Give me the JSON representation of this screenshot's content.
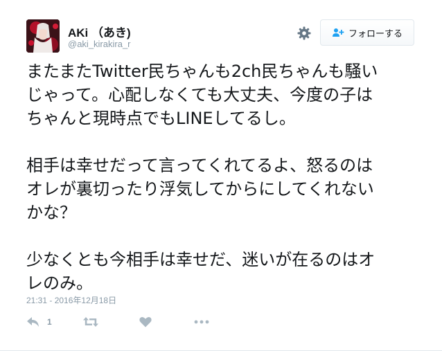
{
  "user": {
    "display_name": "AKi （あき)",
    "handle": "@aki_kirakira_r"
  },
  "actions_top": {
    "follow_label": "フォロー",
    "follow_suffix": "する",
    "icons": [
      "gear-icon",
      "add-user-icon"
    ]
  },
  "tweet": {
    "paragraph1": "またまたTwitter民ちゃんも2ch民ちゃんも騒い\nじゃって。心配しなくても大丈夫、今度の子は\nちゃんと現時点でもLINEしてるし。",
    "paragraph2": "相手は幸せだって言ってくれてるよ、怒るのは\nオレが裏切ったり浮気してからにしてくれない\nかな？",
    "paragraph3": "少なくとも今相手は幸せだ、迷いが在るのはオ\nレのみ。",
    "timestamp": "21:31 - 2016年12月18日"
  },
  "footer": {
    "reply_count": "1",
    "icons": [
      "reply-icon",
      "retweet-icon",
      "heart-icon",
      "more-icon"
    ]
  },
  "colors": {
    "text": "#14171a",
    "secondary": "#8899a6",
    "icon": "#aab8c2",
    "border": "#e1e8ed",
    "accent": "#1da1f2"
  }
}
